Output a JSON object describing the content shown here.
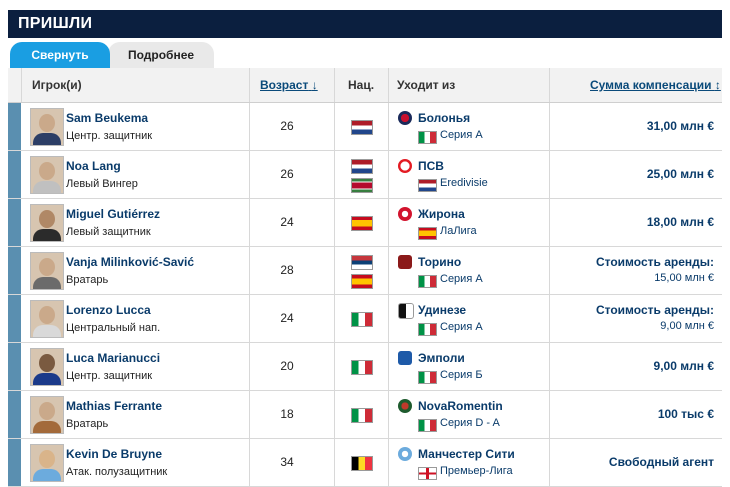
{
  "header": {
    "title": "ПРИШЛИ"
  },
  "tabs": {
    "collapse": "Свернуть",
    "details": "Подробнее"
  },
  "columns": {
    "player": "Игрок(и)",
    "age": "Возраст",
    "age_sort": "↓",
    "nat": "Нац.",
    "from": "Уходит из",
    "fee": "Сумма компенсации",
    "fee_sort": "↕"
  },
  "rows": [
    {
      "name": "Sam Beukema",
      "position": "Центр. защитник",
      "age": "26",
      "club": "Болонья",
      "league": "Серия А",
      "fee": "31,00 млн €"
    },
    {
      "name": "Noa Lang",
      "position": "Левый Вингер",
      "age": "26",
      "club": "ПСВ",
      "league": "Eredivisie",
      "fee": "25,00 млн €"
    },
    {
      "name": "Miguel Gutiérrez",
      "position": "Левый защитник",
      "age": "24",
      "club": "Жирона",
      "league": "ЛаЛига",
      "fee": "18,00 млн €"
    },
    {
      "name": "Vanja Milinković-Savić",
      "position": "Вратарь",
      "age": "28",
      "club": "Торино",
      "league": "Серия А",
      "fee_label": "Стоимость аренды:",
      "fee_value": "15,00 млн €"
    },
    {
      "name": "Lorenzo Lucca",
      "position": "Центральный нап.",
      "age": "24",
      "club": "Удинезе",
      "league": "Серия А",
      "fee_label": "Стоимость аренды:",
      "fee_value": "9,00 млн €"
    },
    {
      "name": "Luca Marianucci",
      "position": "Центр. защитник",
      "age": "20",
      "club": "Эмполи",
      "league": "Серия Б",
      "fee": "9,00 млн €"
    },
    {
      "name": "Mathias Ferrante",
      "position": "Вратарь",
      "age": "18",
      "club": "NovaRomentin",
      "league": "Серия D - A",
      "fee": "100 тыс €"
    },
    {
      "name": "Kevin De Bruyne",
      "position": "Атак. полузащитник",
      "age": "34",
      "club": "Манчестер Сити",
      "league": "Премьер-Лига",
      "fee": "Свободный агент"
    }
  ]
}
